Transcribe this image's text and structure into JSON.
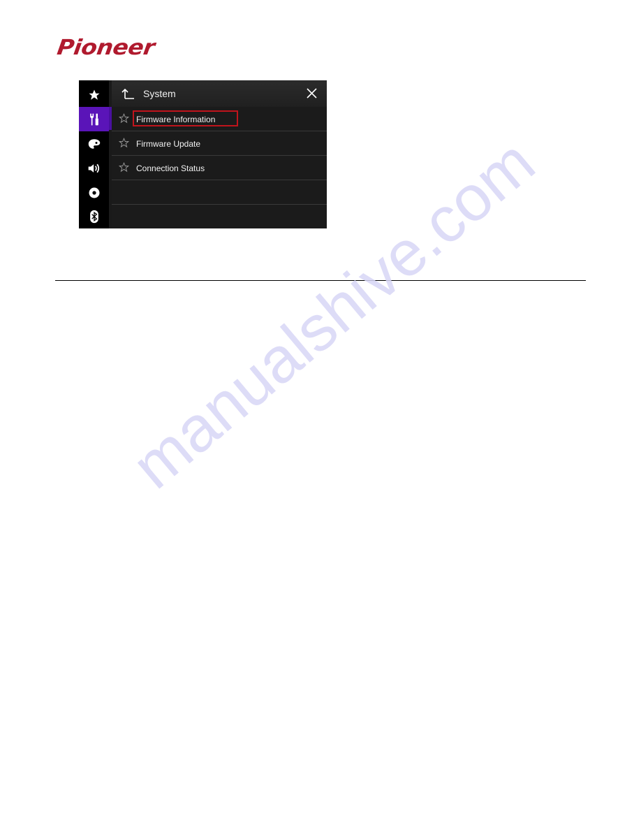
{
  "brand": {
    "logo_text": "Pioneer",
    "color": "#b01a2e"
  },
  "screen": {
    "sidebar": {
      "items": [
        {
          "icon": "star-icon",
          "active": false
        },
        {
          "icon": "tools-icon",
          "active": true
        },
        {
          "icon": "palette-icon",
          "active": false
        },
        {
          "icon": "speaker-icon",
          "active": false
        },
        {
          "icon": "disc-icon",
          "active": false
        },
        {
          "icon": "bluetooth-icon",
          "active": false
        }
      ],
      "active_color": "#5a14b8"
    },
    "header": {
      "title": "System",
      "back_icon": "back-arrow-icon",
      "close_icon": "close-icon"
    },
    "list": {
      "items": [
        {
          "label": "Firmware Information",
          "highlighted": true
        },
        {
          "label": "Firmware Update",
          "highlighted": false
        },
        {
          "label": "Connection Status",
          "highlighted": false
        }
      ],
      "highlight_color": "#c0141c"
    }
  },
  "watermark": "manualshive.com"
}
